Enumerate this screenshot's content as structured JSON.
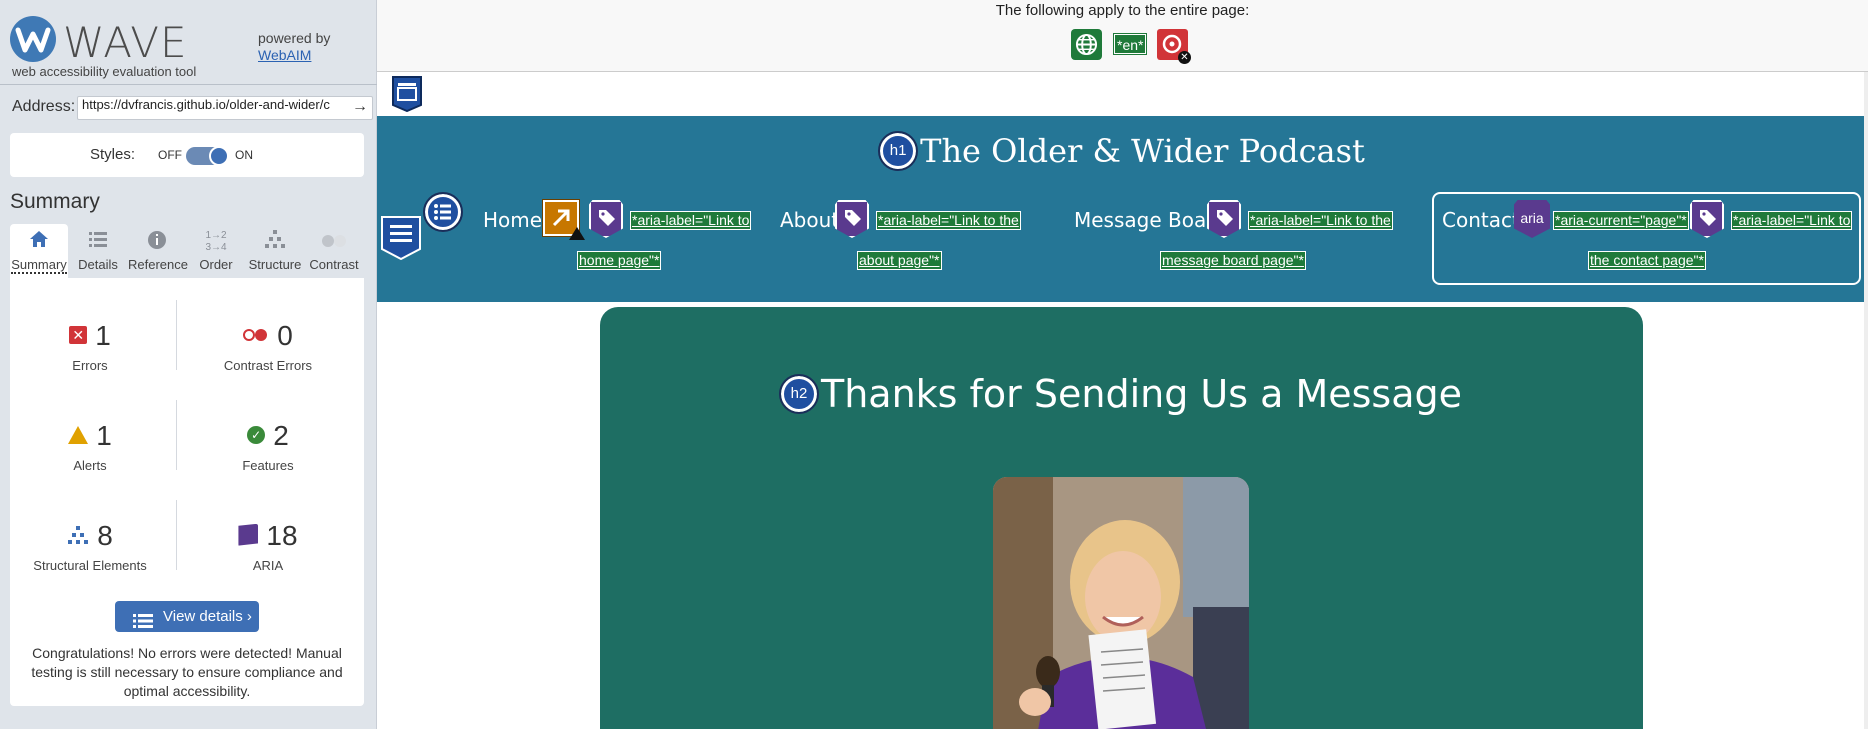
{
  "sidebar": {
    "brand": "WAVE",
    "tagline": "web accessibility evaluation tool",
    "powered_by": "powered by",
    "webaim_link": "WebAIM",
    "address_label": "Address:",
    "address_value": "https://dvfrancis.github.io/older-and-wider/c",
    "styles_label": "Styles:",
    "styles_off": "OFF",
    "styles_on": "ON",
    "summary_title": "Summary",
    "tabs": [
      {
        "label": "Summary",
        "icon": "home-icon",
        "active": true
      },
      {
        "label": "Details",
        "icon": "list-icon"
      },
      {
        "label": "Reference",
        "icon": "info-icon"
      },
      {
        "label": "Order",
        "icon": "order-icon"
      },
      {
        "label": "Structure",
        "icon": "structure-icon"
      },
      {
        "label": "Contrast",
        "icon": "contrast-icon"
      }
    ],
    "stats": {
      "errors": {
        "count": "1",
        "label": "Errors"
      },
      "contrast_errors": {
        "count": "0",
        "label": "Contrast Errors"
      },
      "alerts": {
        "count": "1",
        "label": "Alerts"
      },
      "features": {
        "count": "2",
        "label": "Features"
      },
      "structural": {
        "count": "8",
        "label": "Structural Elements"
      },
      "aria": {
        "count": "18",
        "label": "ARIA"
      }
    },
    "view_details": "View details ›",
    "congrats": "Congratulations! No errors were detected! Manual testing is still necessary to ensure compliance and optimal accessibility."
  },
  "page_apply": {
    "text": "The following apply to the entire page:",
    "lang_tag": "*en*"
  },
  "site": {
    "title": "The Older & Wider Podcast",
    "h1_badge": "h1",
    "h2_badge": "h2",
    "nav": [
      {
        "label": "Home",
        "aria_line1": "*aria-label=\"Link to",
        "aria_line2": "home page\"*"
      },
      {
        "label": "About",
        "aria_line1": "*aria-label=\"Link to the",
        "aria_line2": "about page\"*"
      },
      {
        "label": "Message Board",
        "aria_line1": "*aria-label=\"Link to the",
        "aria_line2": "message board page\"*"
      },
      {
        "label": "Contact",
        "aria_badge": "aria",
        "aria_current": "*aria-current=\"page\"*",
        "aria_line1": "*aria-label=\"Link to",
        "aria_line2": "the contact page\"*"
      }
    ],
    "heading": "Thanks for Sending Us a Message"
  },
  "colors": {
    "header_bg": "#257696",
    "card_bg": "#1e6e63",
    "wave_blue": "#3e6fb5",
    "error_red": "#d13438",
    "aria_purple": "#5a3a8e"
  }
}
